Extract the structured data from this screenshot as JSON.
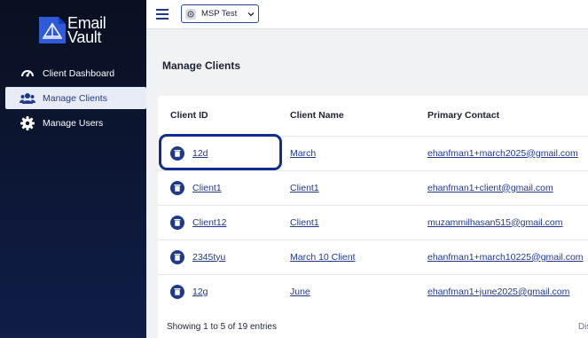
{
  "brand": {
    "line1": "Email",
    "line2": "Vault",
    "mark_color": "#2f5bd9"
  },
  "sidebar": {
    "items": [
      {
        "label": "Client Dashboard",
        "icon": "speedometer-icon",
        "active": false
      },
      {
        "label": "Manage Clients",
        "icon": "users-icon",
        "active": true
      },
      {
        "label": "Manage Users",
        "icon": "gear-icon",
        "active": false
      }
    ]
  },
  "topbar": {
    "tenant": "MSP Test"
  },
  "page": {
    "title": "Manage Clients"
  },
  "table": {
    "headers": [
      "Client ID",
      "Client Name",
      "Primary Contact"
    ],
    "rows": [
      {
        "id": "12d",
        "name": "March",
        "contact": "ehanfman1+march2025@gmail.com"
      },
      {
        "id": "Client1",
        "name": "Client1",
        "contact": "ehanfman1+client@gmail.com"
      },
      {
        "id": "Client12",
        "name": "Client1",
        "contact": "muzammilhasan515@gmail.com"
      },
      {
        "id": "2345tyu",
        "name": "March 10 Client",
        "contact": "ehanfman1+march10225@gmail.com"
      },
      {
        "id": "12g",
        "name": "June",
        "contact": "ehanfman1+june2025@gmail.com"
      }
    ]
  },
  "footer": {
    "info": "Showing 1 to 5 of 19 entries",
    "right": "Dis"
  },
  "colors": {
    "accent": "#1f3a8a",
    "sidebar_bg": "#0a1021",
    "highlight": "#0f2d8f"
  }
}
